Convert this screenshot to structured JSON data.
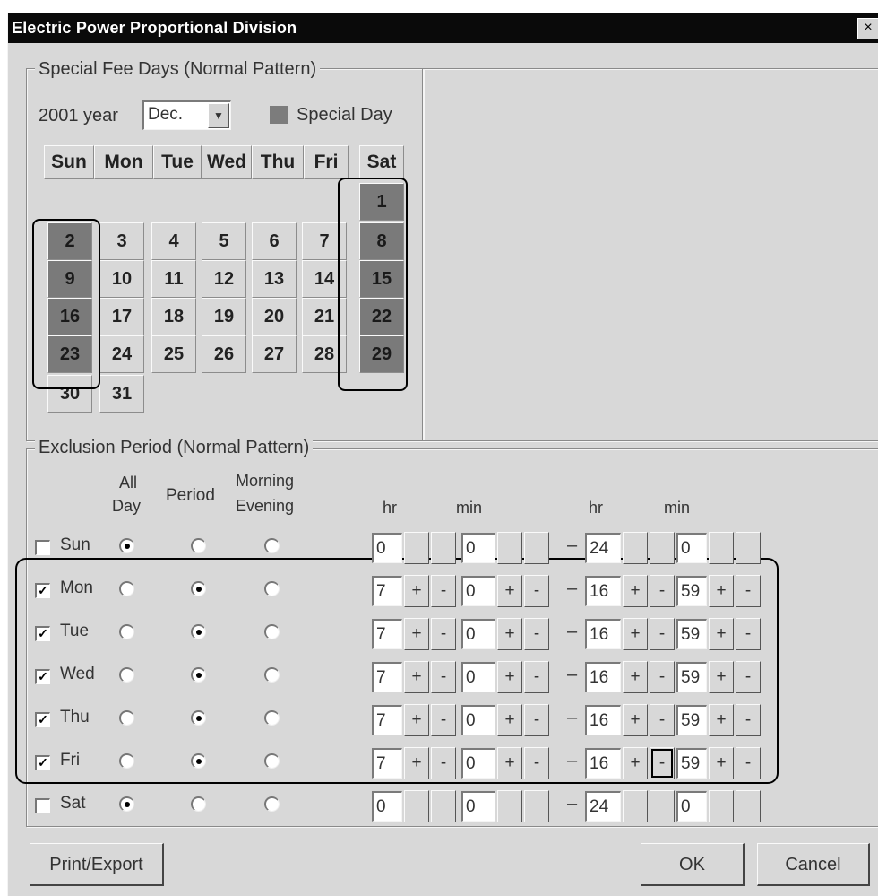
{
  "window": {
    "title": "Electric Power Proportional Division",
    "close_glyph": "×"
  },
  "special_fee": {
    "group_label": "Special Fee Days (Normal Pattern)",
    "year_label": "2001 year",
    "month_value": "Dec.",
    "legend_label": "Special Day",
    "legend_color": "#7c7c7c",
    "weekdays": [
      "Sun",
      "Mon",
      "Tue",
      "Wed",
      "Thu",
      "Fri",
      "Sat"
    ],
    "days": [
      {
        "n": "1",
        "special": true
      },
      {
        "n": "2",
        "special": true
      },
      {
        "n": "3",
        "special": false
      },
      {
        "n": "4",
        "special": false
      },
      {
        "n": "5",
        "special": false
      },
      {
        "n": "6",
        "special": false
      },
      {
        "n": "7",
        "special": false
      },
      {
        "n": "8",
        "special": true
      },
      {
        "n": "9",
        "special": true
      },
      {
        "n": "10",
        "special": false
      },
      {
        "n": "11",
        "special": false
      },
      {
        "n": "12",
        "special": false
      },
      {
        "n": "13",
        "special": false
      },
      {
        "n": "14",
        "special": false
      },
      {
        "n": "15",
        "special": true
      },
      {
        "n": "16",
        "special": true
      },
      {
        "n": "17",
        "special": false
      },
      {
        "n": "18",
        "special": false
      },
      {
        "n": "19",
        "special": false
      },
      {
        "n": "20",
        "special": false
      },
      {
        "n": "21",
        "special": false
      },
      {
        "n": "22",
        "special": true
      },
      {
        "n": "23",
        "special": true
      },
      {
        "n": "24",
        "special": false
      },
      {
        "n": "25",
        "special": false
      },
      {
        "n": "26",
        "special": false
      },
      {
        "n": "27",
        "special": false
      },
      {
        "n": "28",
        "special": false
      },
      {
        "n": "29",
        "special": true
      },
      {
        "n": "30",
        "special": false
      },
      {
        "n": "31",
        "special": false
      }
    ],
    "first_weekday_index": 6
  },
  "exclusion": {
    "group_label": "Exclusion Period (Normal Pattern)",
    "col_allday_1": "All",
    "col_allday_2": "Day",
    "col_period": "Period",
    "col_morning": "Morning",
    "col_evening": "Evening",
    "hr_label": "hr",
    "min_label": "min",
    "dash": "–",
    "plus": "+",
    "minus": "-",
    "rows": [
      {
        "day": "Sun",
        "checked": false,
        "mode": "allday",
        "sh": "0",
        "sm": "0",
        "eh": "24",
        "em": "0",
        "spin_labels": false
      },
      {
        "day": "Mon",
        "checked": true,
        "mode": "period",
        "sh": "7",
        "sm": "0",
        "eh": "16",
        "em": "59",
        "spin_labels": true
      },
      {
        "day": "Tue",
        "checked": true,
        "mode": "period",
        "sh": "7",
        "sm": "0",
        "eh": "16",
        "em": "59",
        "spin_labels": true
      },
      {
        "day": "Wed",
        "checked": true,
        "mode": "period",
        "sh": "7",
        "sm": "0",
        "eh": "16",
        "em": "59",
        "spin_labels": true
      },
      {
        "day": "Thu",
        "checked": true,
        "mode": "period",
        "sh": "7",
        "sm": "0",
        "eh": "16",
        "em": "59",
        "spin_labels": true
      },
      {
        "day": "Fri",
        "checked": true,
        "mode": "period",
        "sh": "7",
        "sm": "0",
        "eh": "16",
        "em": "59",
        "spin_labels": true
      },
      {
        "day": "Sat",
        "checked": false,
        "mode": "allday",
        "sh": "0",
        "sm": "0",
        "eh": "24",
        "em": "0",
        "spin_labels": false
      }
    ]
  },
  "buttons": {
    "print": "Print/Export",
    "ok": "OK",
    "cancel": "Cancel"
  }
}
